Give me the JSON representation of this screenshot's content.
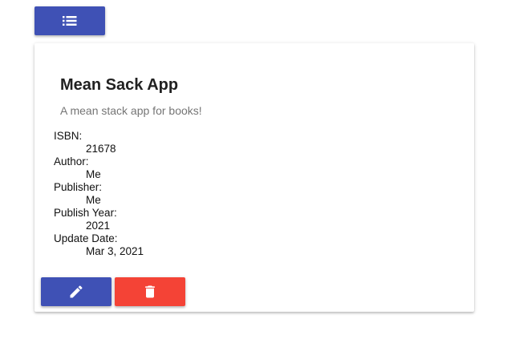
{
  "toolbar": {
    "list_button": {
      "icon": "list-icon",
      "color": "#3f51b5"
    }
  },
  "card": {
    "title": "Mean Sack App",
    "subtitle": "A mean stack app for books!",
    "fields": [
      {
        "label": "ISBN:",
        "value": "21678"
      },
      {
        "label": "Author:",
        "value": "Me"
      },
      {
        "label": "Publisher:",
        "value": "Me"
      },
      {
        "label": "Publish Year:",
        "value": "2021"
      },
      {
        "label": "Update Date:",
        "value": "Mar 3, 2021"
      }
    ],
    "actions": {
      "edit": {
        "icon": "pencil-icon",
        "color": "#3f51b5"
      },
      "delete": {
        "icon": "trash-icon",
        "color": "#f44336"
      }
    }
  },
  "colors": {
    "primary": "#3f51b5",
    "warn": "#f44336",
    "icon": "#ffffff"
  }
}
